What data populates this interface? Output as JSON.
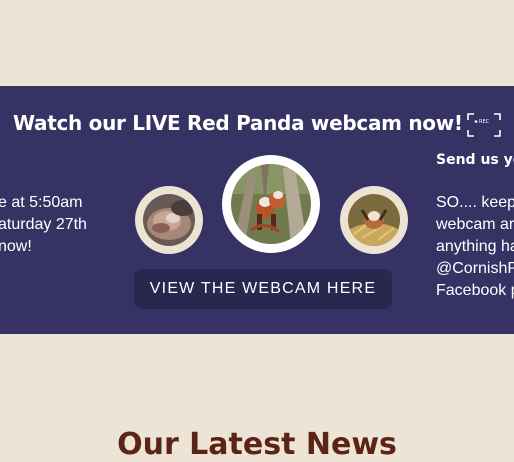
{
  "banner": {
    "title": "Watch our LIVE Red Panda webcam now!",
    "left_text": [
      "e at 5:50am",
      "aturday 27th",
      "now!"
    ],
    "button_label": "VIEW THE WEBCAM HERE",
    "send_heading": "Send us yo",
    "right_text": [
      "SO.... keep",
      "webcam ar",
      "anything ha",
      "@CornishP",
      "Facebook p"
    ]
  },
  "news": {
    "heading": "Our Latest News"
  },
  "colors": {
    "page_background": "#ede4d6",
    "banner_background": "#363264",
    "button_background": "#29264f",
    "news_heading": "#5a2416"
  },
  "icons": {
    "rec": "rec-frame-icon"
  }
}
